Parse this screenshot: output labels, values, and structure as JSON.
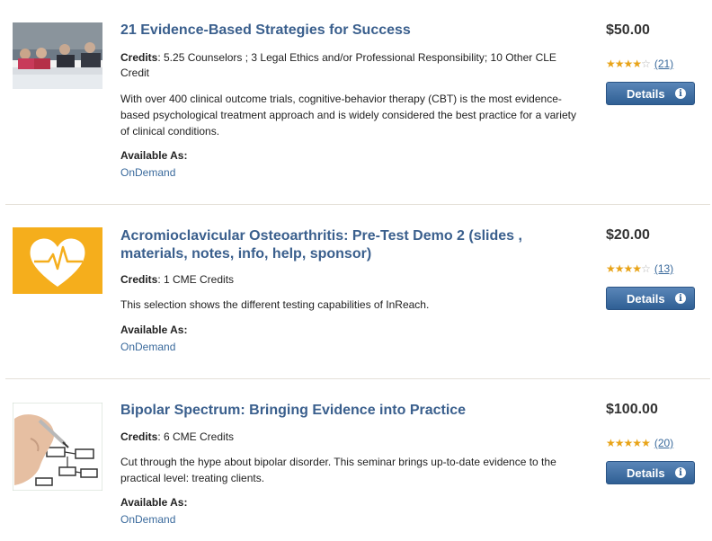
{
  "courses": [
    {
      "title": "21 Evidence-Based Strategies for Success",
      "credits_label": "Credits",
      "credits_value": ": 5.25 Counselors ; 3 Legal Ethics and/or Professional Responsibility; 10 Other CLE Credit",
      "description": "With over 400 clinical outcome trials, cognitive-behavior therapy (CBT) is the most evidence-based psychological treatment approach and is widely considered the best practice for a variety of clinical conditions.",
      "available_label": "Available As:",
      "available_format": "OnDemand",
      "price": "$50.00",
      "rating": 4,
      "rating_max": 5,
      "review_count": "(21)",
      "details_label": "Details",
      "thumbnail_icon": "panel-discussion-photo"
    },
    {
      "title": "Acromioclavicular Osteoarthritis: Pre-Test Demo 2 (slides , materials, notes, info, help, sponsor)",
      "credits_label": "Credits",
      "credits_value": ": 1 CME Credits",
      "description": "This selection shows the different testing capabilities of InReach.",
      "available_label": "Available As:",
      "available_format": "OnDemand",
      "price": "$20.00",
      "rating": 4,
      "rating_max": 5,
      "review_count": "(13)",
      "details_label": "Details",
      "thumbnail_icon": "heart-pulse-icon",
      "thumbnail_color": "#f5ae1c"
    },
    {
      "title": "Bipolar Spectrum: Bringing Evidence into Practice",
      "credits_label": "Credits",
      "credits_value": ": 6 CME Credits",
      "description": "Cut through the hype about bipolar disorder. This seminar brings up-to-date evidence to the practical level: treating clients.",
      "available_label": "Available As:",
      "available_format": "OnDemand",
      "price": "$100.00",
      "rating": 5,
      "rating_max": 5,
      "review_count": "(20)",
      "details_label": "Details",
      "thumbnail_icon": "hand-drawing-flowchart-photo"
    }
  ],
  "info_glyph": "i"
}
